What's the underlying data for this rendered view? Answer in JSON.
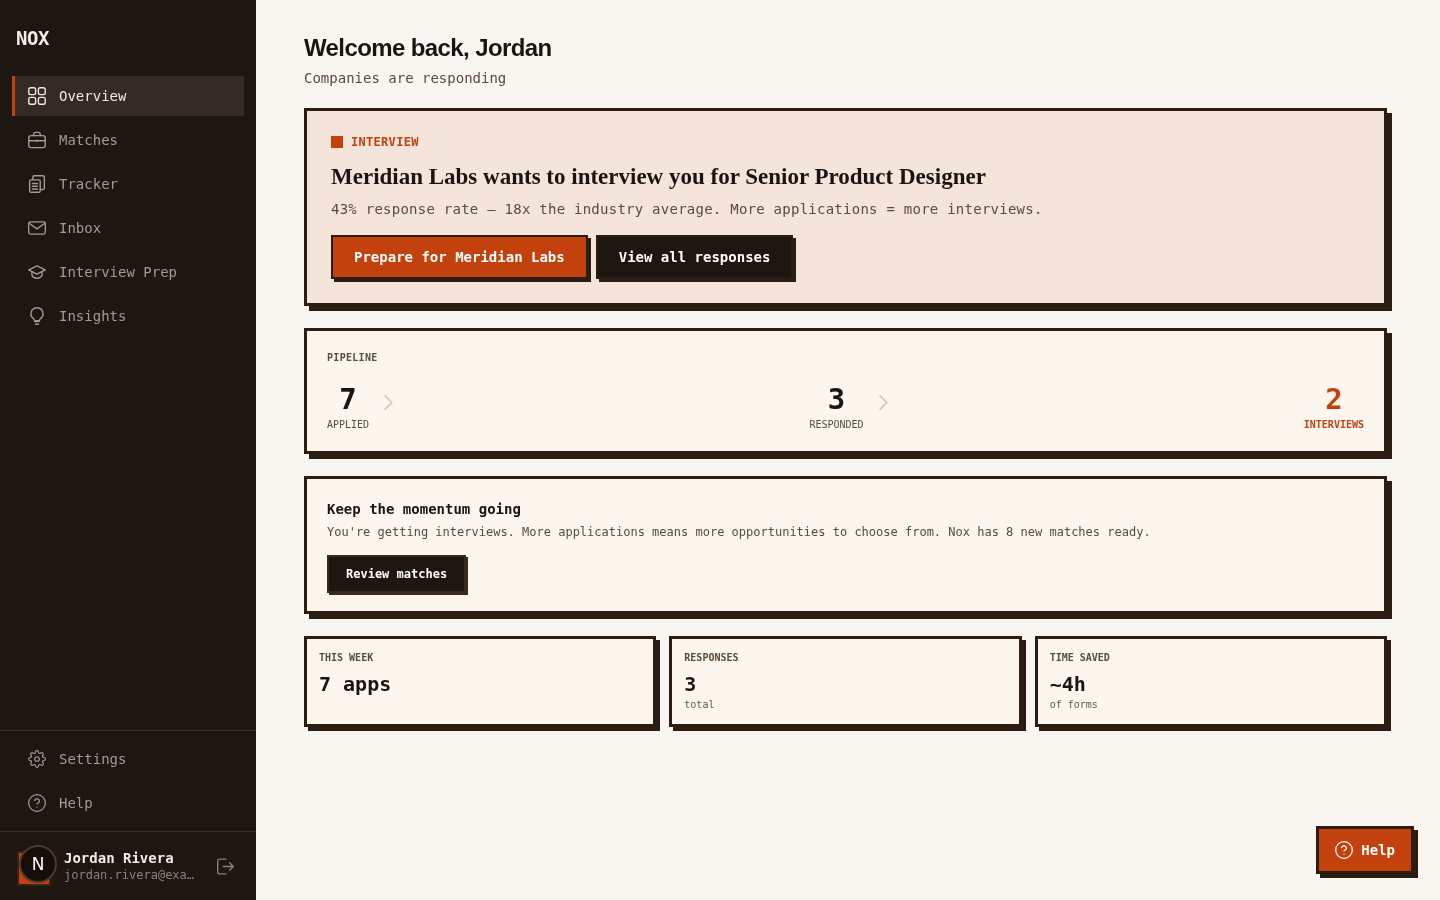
{
  "sidebar": {
    "logo": "NOX",
    "nav_items": [
      {
        "label": "Overview",
        "selected": true
      },
      {
        "label": "Matches",
        "selected": false
      },
      {
        "label": "Tracker",
        "selected": false
      },
      {
        "label": "Inbox",
        "selected": false
      },
      {
        "label": "Interview Prep",
        "selected": false
      },
      {
        "label": "Insights",
        "selected": false
      }
    ],
    "footer_items": [
      {
        "label": "Settings"
      },
      {
        "label": "Help"
      }
    ],
    "user": {
      "badge": "N",
      "name": "Jordan Rivera",
      "email": "jordan.rivera@exa…"
    }
  },
  "header": {
    "title": "Welcome back, Jordan",
    "subtitle": "Companies are responding"
  },
  "interview_card": {
    "tag": "INTERVIEW",
    "title": "Meridian Labs wants to interview you for Senior Product Designer",
    "description": "43% response rate — 18x the industry average. More applications = more interviews.",
    "buttons": [
      {
        "label": "Prepare for Meridian Labs",
        "kind": "primary"
      },
      {
        "label": "View all responses",
        "kind": "secondary"
      }
    ]
  },
  "pipeline": {
    "title": "PIPELINE",
    "stages": [
      {
        "value": "7",
        "label": "APPLIED",
        "highlighted": false
      },
      {
        "value": "3",
        "label": "RESPONDED",
        "highlighted": false
      },
      {
        "value": "2",
        "label": "INTERVIEWS",
        "highlighted": true
      }
    ]
  },
  "momentum": {
    "title": "Keep the momentum going",
    "description": "You're getting interviews. More applications means more opportunities to choose from. Nox has 8 new matches ready.",
    "button": "Review matches"
  },
  "stats": [
    {
      "label": "THIS WEEK",
      "value": "7 apps"
    },
    {
      "label": "RESPONSES",
      "value": "3",
      "note": "total"
    },
    {
      "label": "TIME SAVED",
      "value": "~4h",
      "note": "of forms"
    }
  ],
  "help_button": "Help"
}
